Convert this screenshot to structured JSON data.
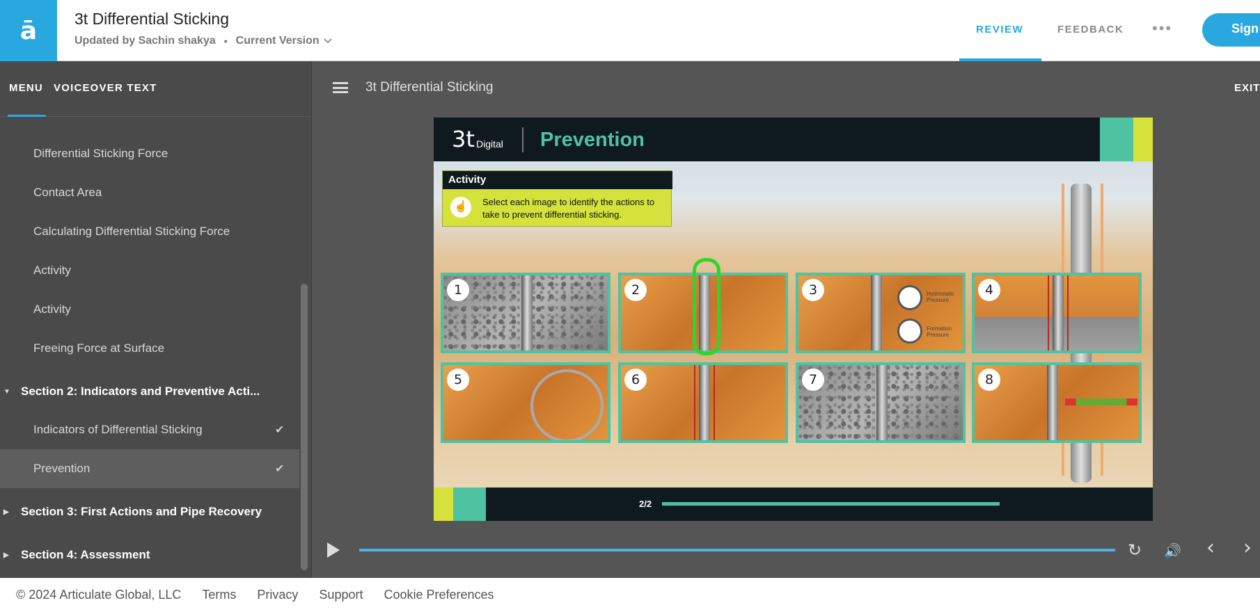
{
  "header": {
    "logo_glyph": "ā",
    "title": "3t Differential Sticking",
    "updated_by": "Updated by Sachin shakya",
    "separator": "•",
    "version_label": "Current Version",
    "tabs": [
      {
        "label": "REVIEW"
      },
      {
        "label": "FEEDBACK"
      }
    ],
    "more_label": "•••",
    "sign_label": "Sign I"
  },
  "sidebar": {
    "tabs": [
      {
        "label": "MENU"
      },
      {
        "label": "VOICEOVER TEXT"
      }
    ],
    "items": [
      {
        "label": "Differential Sticking Force"
      },
      {
        "label": "Contact Area"
      },
      {
        "label": "Calculating Differential Sticking Force"
      },
      {
        "label": "Activity"
      },
      {
        "label": "Activity"
      },
      {
        "label": "Freeing Force at Surface"
      }
    ],
    "section2": {
      "label": "Section 2: Indicators and Preventive Acti..."
    },
    "section2_items": [
      {
        "label": "Indicators of Differential Sticking",
        "check": "✔"
      },
      {
        "label": "Prevention",
        "check": "✔"
      }
    ],
    "section3": {
      "label": "Section 3: First Actions and Pipe Recovery"
    },
    "section4": {
      "label": "Section 4: Assessment"
    }
  },
  "player": {
    "title": "3t Differential Sticking",
    "exit_label": "EXIT"
  },
  "slide": {
    "brand": "3t",
    "brand_sub": "Digital",
    "heading": "Prevention",
    "activity_title": "Activity",
    "activity_icon": "☝",
    "activity_text": "Select each image to identify the actions to take to prevent differential sticking.",
    "tiles": [
      "1",
      "2",
      "3",
      "4",
      "5",
      "6",
      "7",
      "8"
    ],
    "gauge_labels": [
      "Hydrostatic Pressure",
      "Formation Pressure"
    ],
    "page_indicator": "2/2"
  },
  "controls": {
    "replay_icon": "↻",
    "volume_icon": "🔊",
    "prev_icon": "‹",
    "next_icon": "›"
  },
  "footer": {
    "copyright": "© 2024 Articulate Global, LLC",
    "links": [
      {
        "label": "Terms"
      },
      {
        "label": "Privacy"
      },
      {
        "label": "Support"
      },
      {
        "label": "Cookie Preferences"
      }
    ]
  }
}
